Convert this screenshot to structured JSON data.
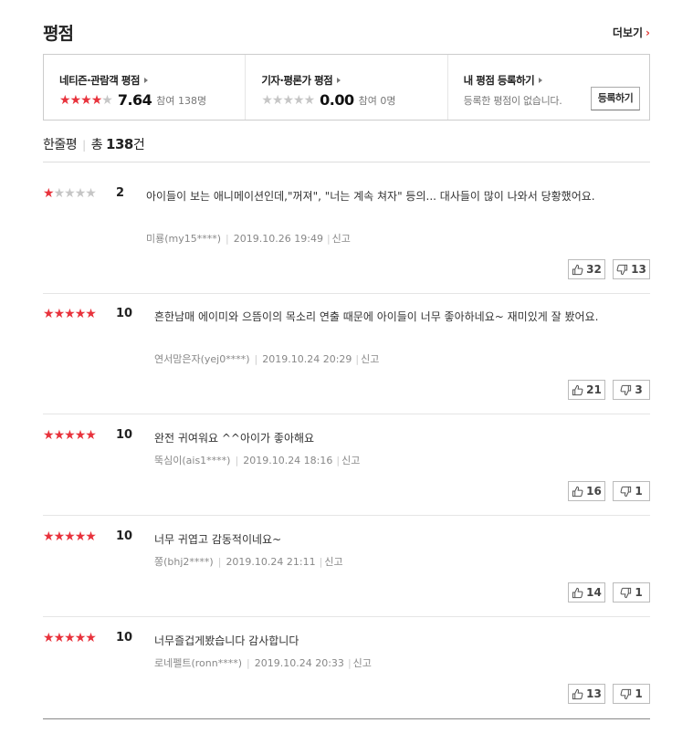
{
  "header": {
    "title": "평점",
    "more_label": "더보기",
    "more_arrow": "›"
  },
  "summary_box": [
    {
      "title": "네티즌·관람객 평점",
      "stars": 4,
      "score": "7.64",
      "count": "참여 138명"
    },
    {
      "title": "기자·평론가 평점",
      "stars": 0,
      "score": "0.00",
      "count": "참여 0명"
    },
    {
      "title": "내 평점 등록하기",
      "sub": "등록한 평점이 없습니다.",
      "button": "등록하기"
    }
  ],
  "review_summary": {
    "label": "한줄평",
    "sep": "|",
    "total_prefix": "총",
    "total_count": "138",
    "total_suffix": "건"
  },
  "reviews": [
    {
      "stars": 1,
      "score": "2",
      "text": "아이들이 보는 애니메이션인데,\"꺼져\", \"너는 계속 쳐자\" 등의... 대사들이 많이 나와서 당황했어요.",
      "user": "미룡(my15****)",
      "date": "2019.10.26 19:49",
      "report": "신고",
      "likes": "32",
      "dislikes": "13"
    },
    {
      "stars": 5,
      "score": "10",
      "text": "흔한남매 에이미와 으뜸이의 목소리 연출 때문에 아이들이 너무 좋아하네요~ 재미있게 잘 봤어요.",
      "user": "연서맘은자(yej0****)",
      "date": "2019.10.24 20:29",
      "report": "신고",
      "likes": "21",
      "dislikes": "3"
    },
    {
      "stars": 5,
      "score": "10",
      "text": "완전 귀여워요 ^^아이가 좋아해요",
      "user": "뚝심이(ais1****)",
      "date": "2019.10.24 18:16",
      "report": "신고",
      "likes": "16",
      "dislikes": "1"
    },
    {
      "stars": 5,
      "score": "10",
      "text": "너무 귀엽고 감동적이네요~",
      "user": "쫑(bhj2****)",
      "date": "2019.10.24 21:11",
      "report": "신고",
      "likes": "14",
      "dislikes": "1"
    },
    {
      "stars": 5,
      "score": "10",
      "text": "너무즐겁게봤습니다 감사합니다",
      "user": "로네펠트(ronn****)",
      "date": "2019.10.24 20:33",
      "report": "신고",
      "likes": "13",
      "dislikes": "1"
    }
  ],
  "colors": {
    "star_on": "#e8323c",
    "star_off": "#c6c6c6",
    "accent": "#e53935"
  }
}
